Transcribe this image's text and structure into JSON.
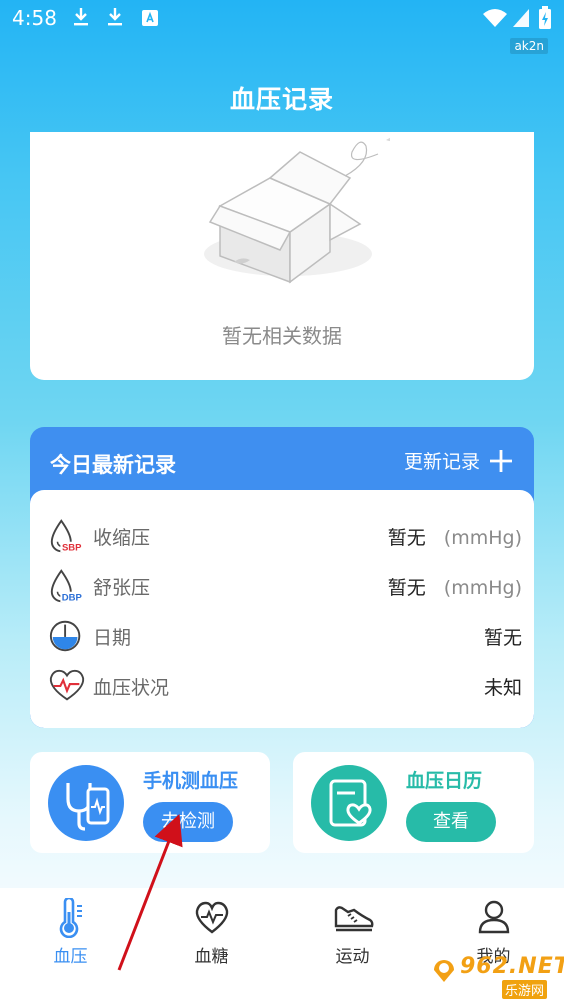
{
  "status_bar": {
    "time": "4:58",
    "carrier": "ak2n"
  },
  "header": {
    "title": "血压记录"
  },
  "empty_state": {
    "text": "暂无相关数据"
  },
  "today_record": {
    "title": "今日最新记录",
    "action_label": "更新记录",
    "rows": [
      {
        "label": "收缩压",
        "value": "暂无",
        "unit": "(mmHg)",
        "badge": "SBP"
      },
      {
        "label": "舒张压",
        "value": "暂无",
        "unit": "(mmHg)",
        "badge": "DBP"
      },
      {
        "label": "日期",
        "value": "暂无"
      },
      {
        "label": "血压状况",
        "value": "未知"
      }
    ]
  },
  "features": [
    {
      "title": "手机测血压",
      "button": "去检测",
      "color": "#3a8ff2"
    },
    {
      "title": "血压日历",
      "button": "查看",
      "color": "#27bba8"
    }
  ],
  "tabs": [
    {
      "label": "血压",
      "icon": "thermometer-icon",
      "active": true
    },
    {
      "label": "血糖",
      "icon": "heart-pulse-icon",
      "active": false
    },
    {
      "label": "运动",
      "icon": "sneaker-icon",
      "active": false
    },
    {
      "label": "我的",
      "icon": "user-icon",
      "active": false
    }
  ],
  "watermark": {
    "main": "962.NET",
    "sub": "乐游网"
  },
  "colors": {
    "accent": "#3a8ff2",
    "teal": "#27bba8",
    "header_bg": "#23b4f4",
    "sbp_red": "#e0303a",
    "dbp_blue": "#2b6fd6"
  }
}
